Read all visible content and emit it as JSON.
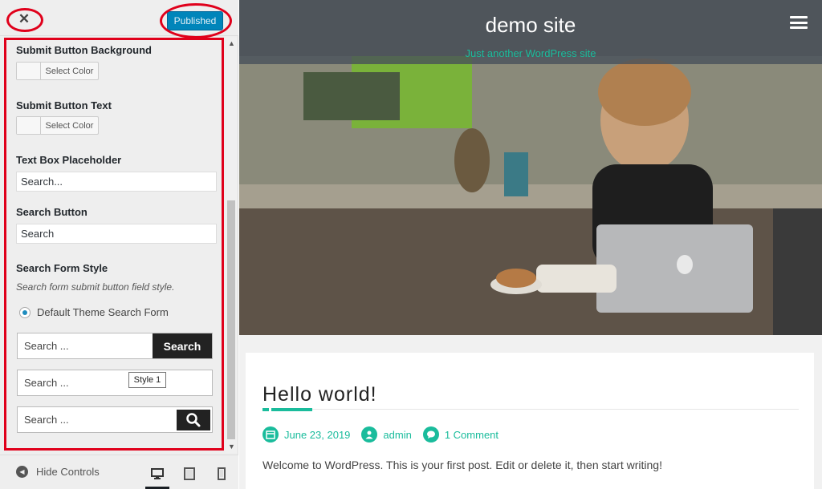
{
  "header": {
    "close_glyph": "✕",
    "publish_label": "Published"
  },
  "panel": {
    "submit_bg_label": "Submit Button Background",
    "submit_bg_button": "Select Color",
    "submit_text_label": "Submit Button Text",
    "submit_text_button": "Select Color",
    "placeholder_label": "Text Box Placeholder",
    "placeholder_value": "Search...",
    "search_button_label": "Search Button",
    "search_button_value": "Search",
    "form_style_label": "Search Form Style",
    "form_style_desc": "Search form submit button field style.",
    "radio_label": "Default Theme Search Form",
    "style1_placeholder": "Search ...",
    "style1_button": "Search",
    "style2_placeholder": "Search ...",
    "style2_tooltip": "Style 1",
    "style3_placeholder": "Search ..."
  },
  "footer": {
    "hide_controls": "Hide Controls"
  },
  "preview": {
    "site_title": "demo site",
    "tagline": "Just another WordPress site",
    "post_title": "Hello world!",
    "date": "June 23, 2019",
    "author": "admin",
    "comments": "1 Comment",
    "excerpt": "Welcome to WordPress. This is your first post. Edit or delete it, then start writing!"
  },
  "colors": {
    "accent": "#1abc9c",
    "publish": "#0085ba",
    "highlight": "#e0001b"
  }
}
